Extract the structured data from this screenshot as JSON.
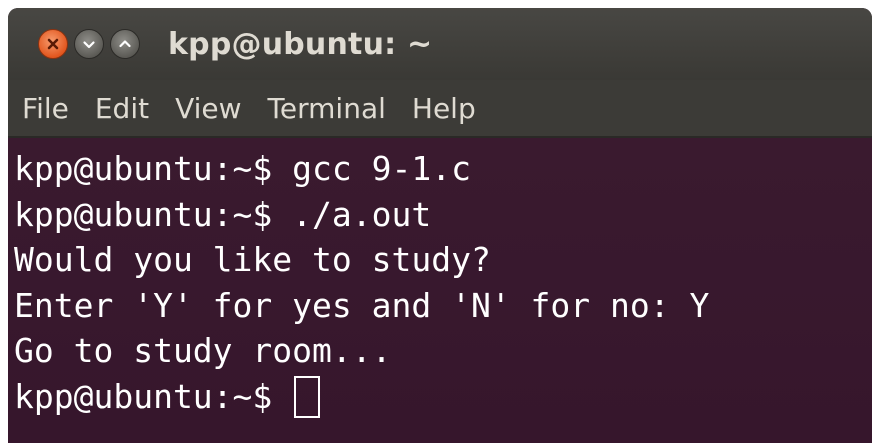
{
  "window": {
    "title": "kpp@ubuntu: ~",
    "buttons": {
      "close": "close-icon",
      "minimize": "minimize-icon",
      "maximize": "maximize-icon"
    }
  },
  "menu": {
    "items": [
      {
        "label": "File"
      },
      {
        "label": "Edit"
      },
      {
        "label": "View"
      },
      {
        "label": "Terminal"
      },
      {
        "label": "Help"
      }
    ]
  },
  "terminal": {
    "lines": [
      "kpp@ubuntu:~$ gcc 9-1.c",
      "kpp@ubuntu:~$ ./a.out",
      "Would you like to study?",
      "Enter 'Y' for yes and 'N' for no: Y",
      "Go to study room...",
      "kpp@ubuntu:~$ "
    ]
  },
  "colors": {
    "terminal_bg": "#36162c",
    "titlebar": "#3c3b37",
    "text": "#ffffff",
    "close_button": "#e2561e"
  }
}
